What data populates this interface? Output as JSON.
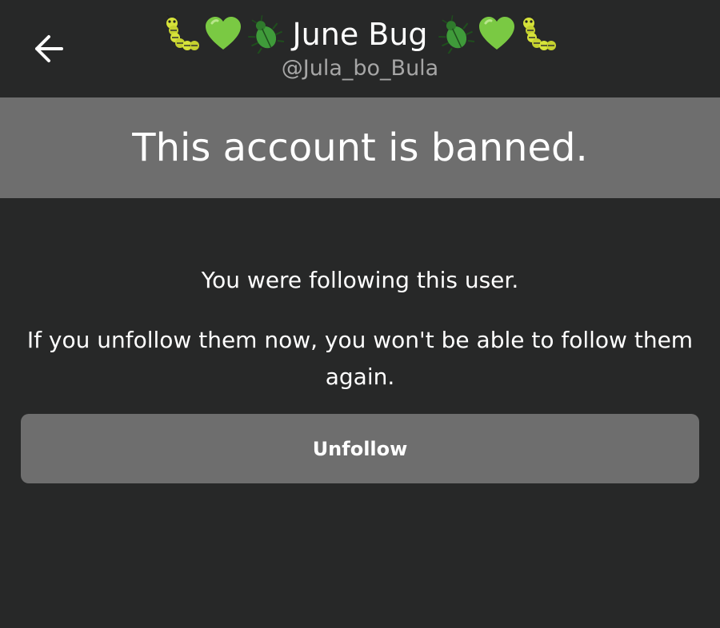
{
  "header": {
    "back_icon": "arrow-left-icon",
    "display_name": "June Bug",
    "handle": "@Jula_bo_Bula",
    "emojis_left": [
      "caterpillar-icon",
      "green-heart-icon",
      "beetle-icon"
    ],
    "emojis_right": [
      "beetle-icon",
      "green-heart-icon",
      "caterpillar-icon"
    ]
  },
  "banner": {
    "text": "This account is banned."
  },
  "message": {
    "line1": "You were following this user.",
    "line2": "If you unfollow them now, you won't be able to follow them again."
  },
  "actions": {
    "unfollow_label": "Unfollow"
  },
  "colors": {
    "background": "#272828",
    "banner": "#6e6e6e",
    "button": "#6e6e6e",
    "handle_text": "#a6a6a6",
    "heart_green": "#7ac943",
    "caterpillar_yellow": "#d6e23a",
    "beetle_green": "#3f9b3a"
  }
}
